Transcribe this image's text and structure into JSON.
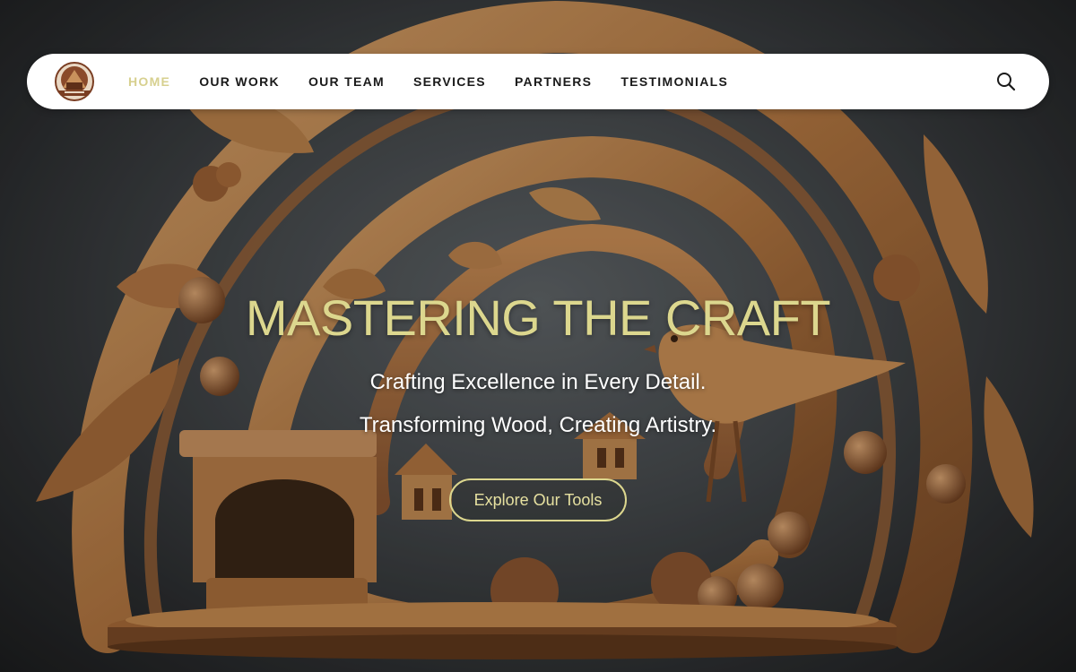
{
  "nav": {
    "items": [
      {
        "label": "HOME",
        "active": true
      },
      {
        "label": "OUR WORK",
        "active": false
      },
      {
        "label": "OUR TEAM",
        "active": false
      },
      {
        "label": "SERVICES",
        "active": false
      },
      {
        "label": "PARTNERS",
        "active": false
      },
      {
        "label": "TESTIMONIALS",
        "active": false
      }
    ],
    "search_icon": "search-icon",
    "logo_icon": "wood-craft-logo"
  },
  "hero": {
    "title": "MASTERING THE CRAFT",
    "subtitle_line1": "Crafting Excellence in Every Detail.",
    "subtitle_line2": "Transforming Wood, Creating Artistry.",
    "cta_label": "Explore Our Tools"
  },
  "colors": {
    "accent": "#dcd78e",
    "nav_active": "#d7d08f",
    "nav_text": "#1a1a1a",
    "navbar_bg": "#ffffff",
    "wood_light": "#c8925a",
    "wood_dark": "#7a4a26"
  }
}
